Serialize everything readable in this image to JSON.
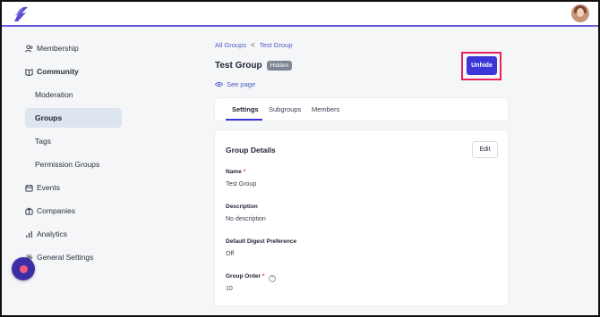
{
  "sidebar": {
    "items": [
      {
        "label": "Membership"
      },
      {
        "label": "Community"
      },
      {
        "label": "Moderation"
      },
      {
        "label": "Groups"
      },
      {
        "label": "Tags"
      },
      {
        "label": "Permission Groups"
      },
      {
        "label": "Events"
      },
      {
        "label": "Companies"
      },
      {
        "label": "Analytics"
      },
      {
        "label": "General Settings"
      }
    ]
  },
  "breadcrumb": {
    "parent": "All Groups",
    "separator": "<",
    "current": "Test Group"
  },
  "header": {
    "title": "Test Group",
    "badge": "Hidden",
    "see_page": "See page",
    "unhide_label": "Unhide"
  },
  "tabs": [
    {
      "label": "Settings"
    },
    {
      "label": "Subgroups"
    },
    {
      "label": "Members"
    }
  ],
  "details": {
    "title": "Group Details",
    "edit_label": "Edit",
    "fields": [
      {
        "label": "Name",
        "required": "*",
        "value": "Test Group"
      },
      {
        "label": "Description",
        "value": "No description"
      },
      {
        "label": "Default Digest Preference",
        "value": "Off"
      },
      {
        "label": "Group Order",
        "required": "*",
        "help": "?",
        "value": "10"
      }
    ]
  },
  "colors": {
    "accent": "#3c36d8",
    "highlight": "#e8225a",
    "badge": "#7e8694",
    "link": "#4b5bc4"
  },
  "icons": {
    "logo": "app-logo-icon",
    "membership": "users-icon",
    "community": "book-icon",
    "events": "calendar-icon",
    "companies": "briefcase-icon",
    "analytics": "bar-chart-icon",
    "settings": "gear-icon",
    "see_page": "eye-icon"
  }
}
